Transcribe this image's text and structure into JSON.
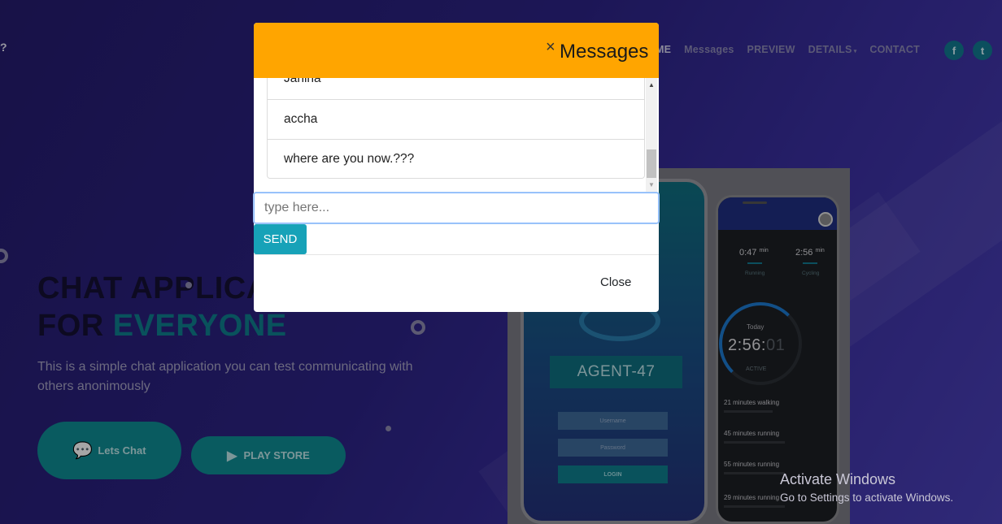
{
  "background": {
    "brand_fragment": "?",
    "nav": {
      "home_fragment": "ME",
      "items": [
        "Messages",
        "PREVIEW",
        "DETAILS",
        "CONTACT"
      ]
    },
    "social": {
      "facebook": "f",
      "twitter": "t"
    },
    "hero": {
      "title_line1": "CHAT APPLICA",
      "title_line2_prefix": "FOR ",
      "title_line2_accent": "EVERYONE",
      "description": "This is a simple chat application you can test communicating with others anonimously"
    },
    "buttons": {
      "chat": "Lets Chat",
      "play": "PLAY STORE"
    },
    "phone_login": {
      "agent": "AGENT-47",
      "username_placeholder": "Username",
      "password_placeholder": "Password",
      "login": "LOGIN"
    },
    "phone_stats": {
      "running_time": "0:47",
      "running_unit": "min",
      "running_label": "Running",
      "cycling_time": "2:56",
      "cycling_unit": "min",
      "cycling_label": "Cycling",
      "today": "Today",
      "clock_main": "2:56:",
      "clock_dim": "01",
      "active": "ACTIVE",
      "activities": [
        "21 minutes walking",
        "45 minutes running",
        "55 minutes running",
        "29 minutes running"
      ]
    },
    "activate": {
      "title": "Activate Windows",
      "subtitle": "Go to Settings to activate Windows."
    }
  },
  "modal": {
    "close_symbol": "×",
    "title": "Messages",
    "messages": [
      "Janina",
      "accha",
      "where are you now.???"
    ],
    "input_placeholder": "type here...",
    "send_label": "SEND",
    "close_label": "Close"
  }
}
